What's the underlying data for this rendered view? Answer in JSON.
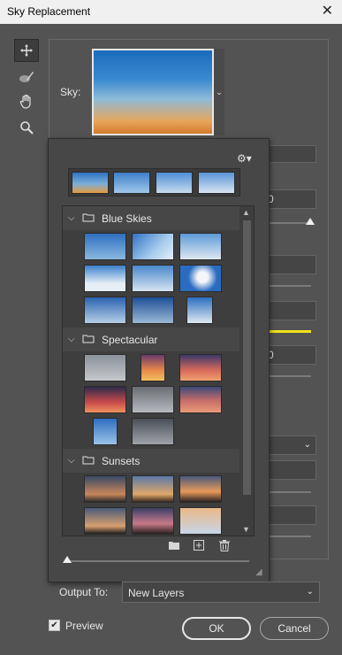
{
  "window": {
    "title": "Sky Replacement",
    "close_glyph": "✕"
  },
  "tools": [
    {
      "name": "move-tool-icon"
    },
    {
      "name": "sky-brush-icon"
    },
    {
      "name": "hand-tool-icon"
    },
    {
      "name": "zoom-tool-icon"
    }
  ],
  "sky": {
    "label": "Sky:",
    "dropdown_glyph": "⌄"
  },
  "background_fields": {
    "partial_value_1": "0",
    "partial_value_2": "0"
  },
  "preset_panel": {
    "settings_glyph": "⚙▾",
    "groups": [
      {
        "name": "Blue Skies",
        "expanded": true
      },
      {
        "name": "Spectacular",
        "expanded": true
      },
      {
        "name": "Sunsets",
        "expanded": true
      }
    ]
  },
  "output": {
    "label": "Output To:",
    "value": "New Layers"
  },
  "preview": {
    "label": "Preview",
    "checked": true
  },
  "buttons": {
    "ok": "OK",
    "cancel": "Cancel"
  },
  "colors": {
    "accent_line": "#f2e21a"
  }
}
